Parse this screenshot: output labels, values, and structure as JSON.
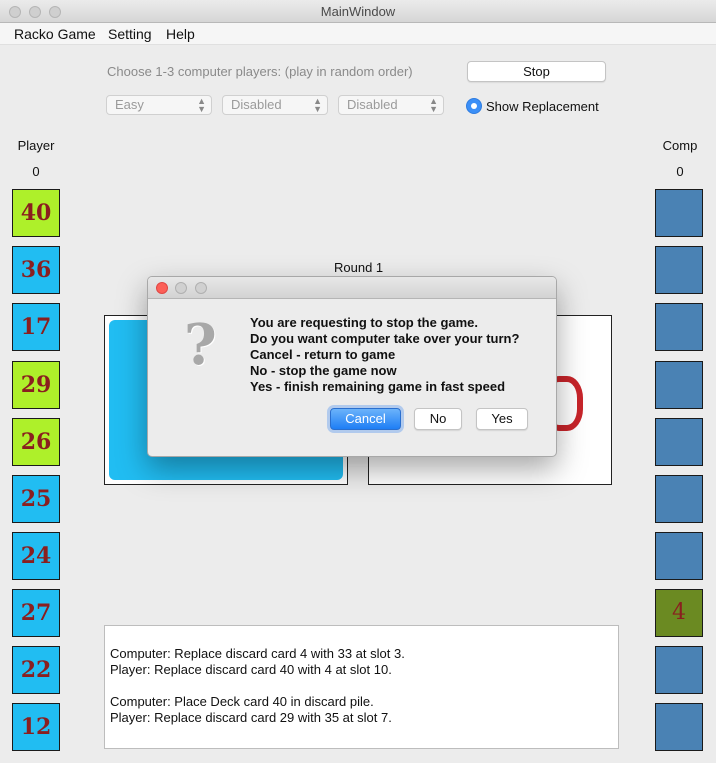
{
  "window": {
    "title": "MainWindow"
  },
  "menu": [
    "Racko Game",
    "Setting",
    "Help"
  ],
  "controls": {
    "hint": "Choose 1-3 computer players: (play in random order)",
    "stop_label": "Stop",
    "selects": [
      "Easy",
      "Disabled",
      "Disabled"
    ],
    "show_replacement_label": "Show Replacement",
    "show_replacement_checked": true
  },
  "player": {
    "label": "Player",
    "score": "0",
    "cards": [
      {
        "value": "40",
        "color": "green"
      },
      {
        "value": "36",
        "color": "blue"
      },
      {
        "value": "17",
        "color": "blue"
      },
      {
        "value": "29",
        "color": "green"
      },
      {
        "value": "26",
        "color": "green"
      },
      {
        "value": "25",
        "color": "blue"
      },
      {
        "value": "24",
        "color": "blue"
      },
      {
        "value": "27",
        "color": "blue"
      },
      {
        "value": "22",
        "color": "blue"
      },
      {
        "value": "12",
        "color": "blue"
      }
    ]
  },
  "computer": {
    "label": "Comp",
    "score": "0",
    "cards": [
      "",
      "",
      "",
      "",
      "",
      "",
      "",
      "4",
      "",
      ""
    ]
  },
  "board": {
    "round_label": "Round 1"
  },
  "log": [
    "Computer: Replace discard card 4 with 33 at slot 3.",
    "Player: Replace discard card 40 with 4 at slot 10.",
    "",
    "Computer: Place Deck card 40 in discard pile.",
    "Player: Replace discard card 29 with 35 at slot 7."
  ],
  "dialog": {
    "icon": "question-mark-icon",
    "message": [
      "You are requesting to stop the game.",
      "Do you want computer take over your turn?",
      "Cancel - return to game",
      "No - stop the game now",
      "Yes - finish remaining game in fast speed"
    ],
    "buttons": {
      "cancel": "Cancel",
      "no": "No",
      "yes": "Yes"
    }
  },
  "colors": {
    "card_blue": "#21bdf2",
    "card_green": "#aef02a",
    "comp_card": "#4a82b4",
    "comp_revealed": "#6b8a22",
    "card_text": "#8a1f1f",
    "accent": "#1e7ef5"
  }
}
